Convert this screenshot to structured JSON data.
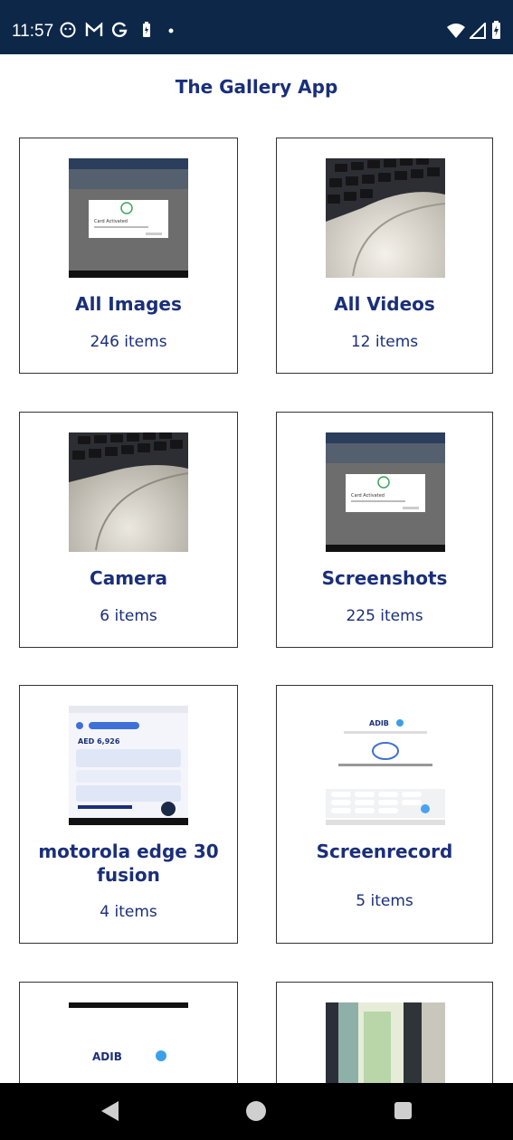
{
  "status_bar": {
    "time": "11:57",
    "icons_left": [
      "smiley-icon",
      "gmail-icon",
      "google-icon",
      "battery-saver-icon",
      "dot-icon"
    ],
    "icons_right": [
      "wifi-icon",
      "signal-icon",
      "battery-icon"
    ]
  },
  "app": {
    "title": "The Gallery App"
  },
  "albums": [
    {
      "name": "All Images",
      "count": "246 items",
      "thumb": "screenshot-thumbnail"
    },
    {
      "name": "All Videos",
      "count": "12 items",
      "thumb": "keyboard-photo-thumbnail"
    },
    {
      "name": "Camera",
      "count": "6 items",
      "thumb": "keyboard-photo-thumbnail"
    },
    {
      "name": "Screenshots",
      "count": "225 items",
      "thumb": "screenshot-thumbnail"
    },
    {
      "name": "motorola edge 30 fusion",
      "count": "4 items",
      "thumb": "app-screenshot-thumbnail"
    },
    {
      "name": "Screenrecord",
      "count": "5 items",
      "thumb": "pin-screen-thumbnail"
    },
    {
      "name": "",
      "count": "",
      "thumb": "adib-logo-thumbnail"
    },
    {
      "name": "",
      "count": "",
      "thumb": "card-photo-thumbnail"
    }
  ],
  "thumb_texts": {
    "dialog_title": "Card Activated",
    "adib": "ADIB",
    "amount": "AED 6,926"
  },
  "nav_bar": {
    "buttons": [
      "back-icon",
      "home-icon",
      "recents-icon"
    ]
  }
}
